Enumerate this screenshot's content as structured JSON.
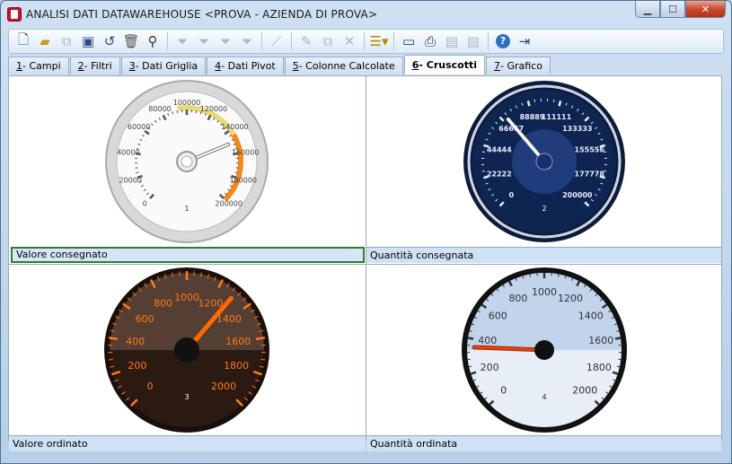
{
  "window": {
    "title": "ANALISI DATI DATAWAREHOUSE <PROVA - AZIENDA DI PROVA>"
  },
  "controls": {
    "min": "▁",
    "max": "☐",
    "close": "✕"
  },
  "toolbar": {
    "icons": [
      "new-icon",
      "open-icon",
      "copy-icon",
      "save-icon",
      "undo-icon",
      "delete-icon",
      "find-icon",
      "filter-icon",
      "filter-add-icon",
      "filter-remove-icon",
      "filter-clear-icon",
      "chart-icon",
      "edit-icon",
      "paste-icon",
      "clear-icon",
      "list-icon",
      "monitor-icon",
      "print-icon",
      "export-icon",
      "import-icon",
      "help-icon",
      "exit-icon"
    ]
  },
  "tabs": [
    {
      "key": "1",
      "label": " - Campi"
    },
    {
      "key": "2",
      "label": " - Filtri"
    },
    {
      "key": "3",
      "label": " - Dati Griglia"
    },
    {
      "key": "4",
      "label": " - Dati Pivot"
    },
    {
      "key": "5",
      "label": " - Colonne Calcolate"
    },
    {
      "key": "6",
      "label": " - Cruscotti",
      "active": true
    },
    {
      "key": "7",
      "label": " - Grafico"
    }
  ],
  "gauges": [
    {
      "caption": "Valore consegnato",
      "index": "1",
      "value": 150000,
      "max": 200000,
      "ticks": [
        "0",
        "20000",
        "40000",
        "60000",
        "80000",
        "100000",
        "120000",
        "140000",
        "160000",
        "180000",
        "200000"
      ]
    },
    {
      "caption": "Quantità consegnata",
      "index": "2",
      "value": 70000,
      "max": 200000,
      "ticks": [
        "0",
        "22222",
        "44444",
        "66667",
        "88889",
        "111111",
        "133333",
        "155556",
        "177778",
        "200000"
      ]
    },
    {
      "caption": "Valore ordinato",
      "index": "3",
      "value": 1300,
      "max": 2000,
      "ticks": [
        "0",
        "200",
        "400",
        "600",
        "800",
        "1000",
        "1200",
        "1400",
        "1600",
        "1800",
        "2000"
      ]
    },
    {
      "caption": "Quantità ordinata",
      "index": "4",
      "value": 350,
      "max": 2000,
      "ticks": [
        "0",
        "200",
        "400",
        "600",
        "800",
        "1000",
        "1200",
        "1400",
        "1600",
        "1800",
        "2000"
      ]
    }
  ]
}
